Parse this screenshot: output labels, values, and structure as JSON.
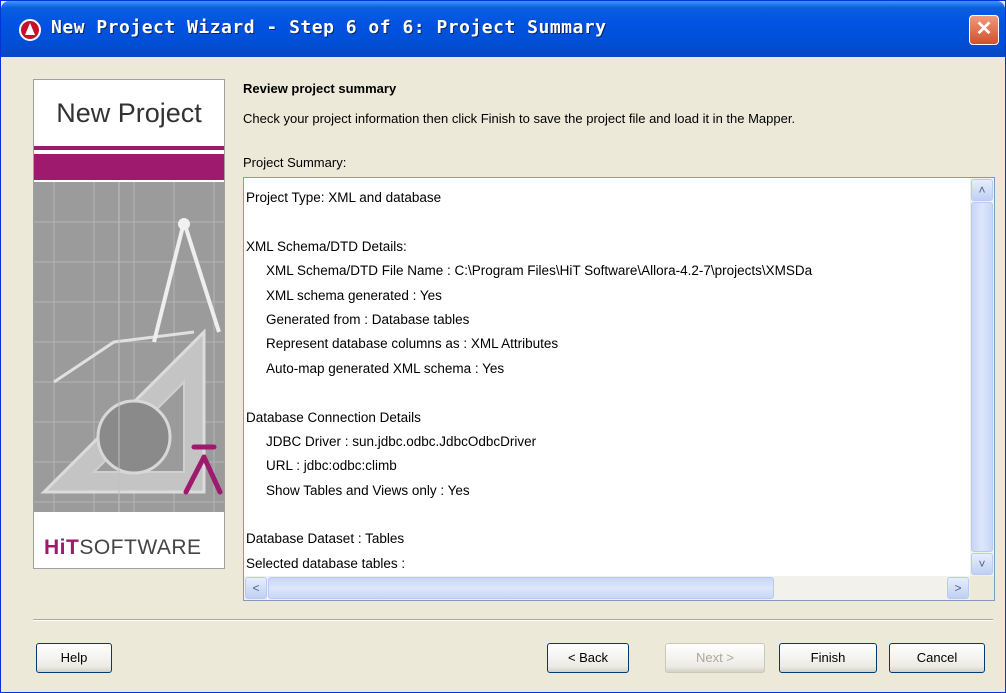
{
  "window": {
    "title": "New Project Wizard - Step 6 of 6: Project Summary",
    "close_label": "✕"
  },
  "banner": {
    "title": "New Project",
    "logo_bold": "HiT",
    "logo_rest": "SOFTWARE"
  },
  "content": {
    "heading": "Review project summary",
    "description": "Check your project information then click Finish to save the project file and load it in the Mapper.",
    "summary_label": "Project Summary:",
    "summary_lines": [
      {
        "text": "Project Type: XML and database",
        "indent": false
      },
      {
        "text": "",
        "indent": false
      },
      {
        "text": "XML Schema/DTD Details:",
        "indent": false
      },
      {
        "text": "XML Schema/DTD File Name : C:\\Program Files\\HiT Software\\Allora-4.2-7\\projects\\XMSDa",
        "indent": true
      },
      {
        "text": "XML schema generated : Yes",
        "indent": true
      },
      {
        "text": "Generated from : Database tables",
        "indent": true
      },
      {
        "text": "Represent database columns as : XML Attributes",
        "indent": true
      },
      {
        "text": "Auto-map generated XML schema : Yes",
        "indent": true
      },
      {
        "text": "",
        "indent": false
      },
      {
        "text": "Database Connection Details",
        "indent": false
      },
      {
        "text": "JDBC Driver : sun.jdbc.odbc.JdbcOdbcDriver",
        "indent": true
      },
      {
        "text": "URL : jdbc:odbc:climb",
        "indent": true
      },
      {
        "text": "Show Tables and Views only : Yes",
        "indent": true
      },
      {
        "text": "",
        "indent": false
      },
      {
        "text": "Database Dataset : Tables",
        "indent": false
      },
      {
        "text": "Selected database tables :",
        "indent": false
      }
    ]
  },
  "scroll": {
    "up": "˄",
    "down": "˅",
    "left": "<",
    "right": ">"
  },
  "buttons": {
    "help": "Help",
    "back": "< Back",
    "next": "Next >",
    "finish": "Finish",
    "cancel": "Cancel"
  }
}
